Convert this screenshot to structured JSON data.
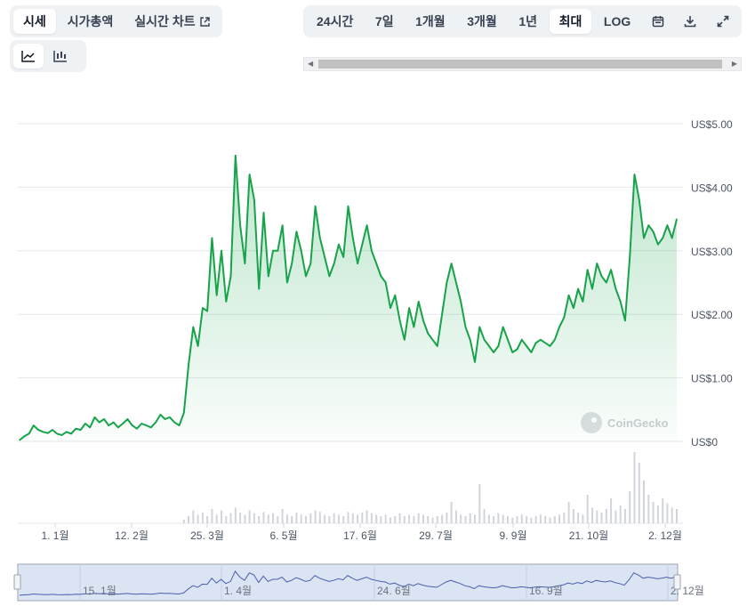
{
  "tabs": [
    {
      "label": "시세",
      "active": true
    },
    {
      "label": "시가총액",
      "active": false
    },
    {
      "label": "실시간 차트",
      "active": false
    }
  ],
  "views": [
    {
      "icon": "line-chart-icon",
      "active": true
    },
    {
      "icon": "candlestick-chart-icon",
      "active": false
    }
  ],
  "ranges": [
    {
      "label": "24시간",
      "active": false
    },
    {
      "label": "7일",
      "active": false
    },
    {
      "label": "1개월",
      "active": false
    },
    {
      "label": "3개월",
      "active": false
    },
    {
      "label": "1년",
      "active": false
    },
    {
      "label": "최대",
      "active": true
    },
    {
      "label": "LOG",
      "active": false
    }
  ],
  "tools": {
    "calendar_icon": "calendar-icon",
    "download_icon": "download-icon",
    "fullscreen_icon": "fullscreen-icon"
  },
  "watermark": "CoinGecko",
  "colors": {
    "line": "#16a34a",
    "fill_top": "#16a34a",
    "volume": "#d1d5db",
    "navigator": "#dbe4f3"
  },
  "chart_data": {
    "type": "area",
    "title": "",
    "ylabel": "",
    "ylim": [
      0,
      5
    ],
    "y_ticks": [
      "US$0",
      "US$1.00",
      "US$2.00",
      "US$3.00",
      "US$4.00",
      "US$5.00"
    ],
    "y_tick_values": [
      0,
      1,
      2,
      3,
      4,
      5
    ],
    "x_ticks": [
      "1. 1월",
      "12. 2월",
      "25. 3월",
      "6. 5월",
      "17. 6월",
      "29. 7월",
      "9. 9월",
      "21. 10월",
      "2. 12월"
    ],
    "navigator_ticks": [
      "15. 1월",
      "1. 4월",
      "24. 6월",
      "16. 9월",
      "2. 12월"
    ],
    "series": [
      {
        "values": [
          0.02,
          0.08,
          0.12,
          0.25,
          0.18,
          0.15,
          0.13,
          0.18,
          0.12,
          0.1,
          0.15,
          0.12,
          0.2,
          0.18,
          0.28,
          0.22,
          0.38,
          0.3,
          0.35,
          0.25,
          0.3,
          0.22,
          0.28,
          0.35,
          0.25,
          0.2,
          0.28,
          0.25,
          0.22,
          0.3,
          0.42,
          0.35,
          0.38,
          0.3,
          0.25,
          0.45,
          1.2,
          1.8,
          1.5,
          2.1,
          2.05,
          3.2,
          2.3,
          3.0,
          2.2,
          2.6,
          4.5,
          3.4,
          2.8,
          4.2,
          3.8,
          2.4,
          3.6,
          2.6,
          3.0,
          3.0,
          3.4,
          2.5,
          2.8,
          3.3,
          3.0,
          2.6,
          2.8,
          3.7,
          3.2,
          2.9,
          2.6,
          2.8,
          3.1,
          2.9,
          3.7,
          3.2,
          2.8,
          3.1,
          3.4,
          3.0,
          2.8,
          2.6,
          2.5,
          2.1,
          2.3,
          1.9,
          1.6,
          2.1,
          1.8,
          2.2,
          1.9,
          1.7,
          1.6,
          1.5,
          2.0,
          2.5,
          2.8,
          2.5,
          2.2,
          1.8,
          1.6,
          1.25,
          1.8,
          1.6,
          1.5,
          1.4,
          1.5,
          1.8,
          1.6,
          1.4,
          1.45,
          1.6,
          1.5,
          1.4,
          1.55,
          1.6,
          1.55,
          1.5,
          1.6,
          1.8,
          1.95,
          2.3,
          2.1,
          2.4,
          2.2,
          2.7,
          2.4,
          2.8,
          2.6,
          2.5,
          2.7,
          2.4,
          2.2,
          1.9,
          2.9,
          4.2,
          3.8,
          3.2,
          3.4,
          3.3,
          3.1,
          3.2,
          3.4,
          3.2,
          3.5
        ]
      }
    ],
    "volume": {
      "values": [
        0,
        0,
        0,
        0,
        0,
        0,
        0,
        0,
        0,
        0,
        0,
        0,
        0,
        0,
        0,
        0,
        0,
        0,
        0,
        0,
        0,
        0,
        0,
        0,
        0,
        0,
        0,
        0,
        0,
        0,
        0,
        0,
        0,
        0,
        0,
        0.05,
        0.1,
        0.18,
        0.12,
        0.15,
        0.1,
        0.2,
        0.12,
        0.18,
        0.1,
        0.14,
        0.22,
        0.15,
        0.12,
        0.18,
        0.14,
        0.1,
        0.16,
        0.12,
        0.14,
        0.1,
        0.2,
        0.12,
        0.1,
        0.15,
        0.12,
        0.1,
        0.14,
        0.18,
        0.16,
        0.12,
        0.1,
        0.14,
        0.12,
        0.1,
        0.16,
        0.14,
        0.12,
        0.15,
        0.18,
        0.14,
        0.12,
        0.1,
        0.12,
        0.08,
        0.1,
        0.14,
        0.1,
        0.12,
        0.1,
        0.14,
        0.12,
        0.1,
        0.08,
        0.1,
        0.12,
        0.15,
        0.3,
        0.18,
        0.12,
        0.1,
        0.14,
        0.12,
        0.55,
        0.2,
        0.12,
        0.1,
        0.14,
        0.12,
        0.1,
        0.08,
        0.1,
        0.12,
        0.1,
        0.08,
        0.1,
        0.12,
        0.1,
        0.08,
        0.1,
        0.12,
        0.15,
        0.3,
        0.2,
        0.15,
        0.12,
        0.4,
        0.22,
        0.18,
        0.15,
        0.2,
        0.35,
        0.18,
        0.25,
        0.2,
        0.45,
        1.0,
        0.85,
        0.6,
        0.4,
        0.3,
        0.25,
        0.35,
        0.28,
        0.22,
        0.2
      ]
    },
    "grid": true,
    "legend": "none"
  }
}
